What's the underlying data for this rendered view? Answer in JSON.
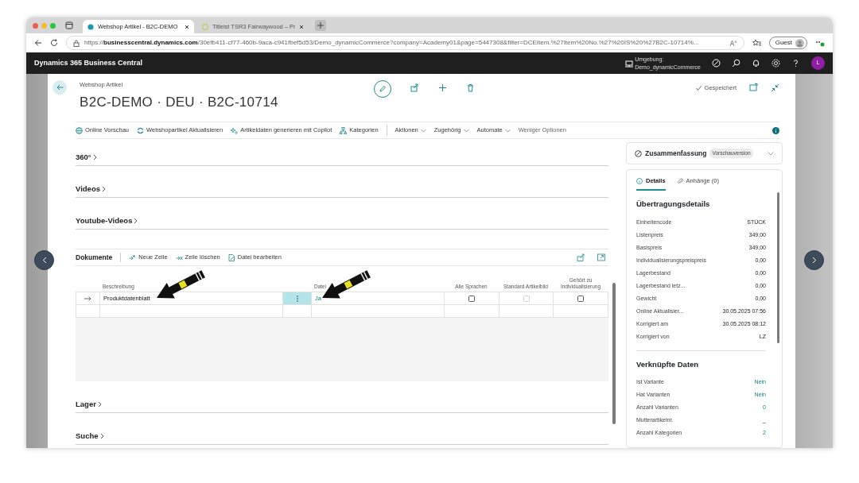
{
  "browser": {
    "tabs": [
      {
        "title": "Webshop Artikel - B2C-DEMO",
        "selected": true
      },
      {
        "title": "Titleist TSR3 Fairwaywood – Pr",
        "selected": false
      }
    ],
    "url": {
      "scheme": "https://",
      "host": "businesscentral.dynamics.com",
      "rest": "/30efb411-cf77-460b-9aca-c941fbef5d53/Demo_dynamicCommerce?company=Academy01&page=5447308&filter=DCEItem.%27Item%20No.%27%20IS%20%27B2C-10714%..."
    },
    "profile": "Guest"
  },
  "app": {
    "title": "Dynamics 365 Business Central",
    "environment_label": "Umgebung:",
    "environment": "Demo_dynamicCommerce",
    "avatar": "L"
  },
  "page": {
    "caption": "Webshop Artikel",
    "title": "B2C-DEMO · DEU · B2C-10714",
    "status": "Gespeichert",
    "actions": [
      {
        "label": "Online Vorschau",
        "kind": "button"
      },
      {
        "label": "Webshopartikel Aktualisieren",
        "kind": "button"
      },
      {
        "label": "Artikeldaten generieren mit Copilot",
        "kind": "button"
      },
      {
        "label": "Kategorien",
        "kind": "button"
      },
      {
        "label": "Aktionen",
        "kind": "menu"
      },
      {
        "label": "Zugehörig",
        "kind": "menu"
      },
      {
        "label": "Automate",
        "kind": "menu"
      },
      {
        "label": "Weniger Optionen",
        "kind": "link"
      }
    ]
  },
  "sections_before": [
    {
      "title": "360°"
    },
    {
      "title": "Videos"
    },
    {
      "title": "Youtube-Videos"
    }
  ],
  "documents": {
    "title": "Dokumente",
    "actions": [
      "Neue Zeile",
      "Zeile löschen",
      "Datei bearbeiten"
    ],
    "columns": [
      "Beschreibung",
      "Datei",
      "Alle Sprachen",
      "Standard Artikelbild",
      "Gehört zu Individualisierung"
    ],
    "rows": [
      {
        "current": true,
        "description": "Produktdatenblatt",
        "file": "Ja",
        "all_languages": false,
        "standard_image": false,
        "standard_disabled": true,
        "customization": false
      },
      {
        "current": false
      }
    ]
  },
  "sections_after": [
    {
      "title": "Lager"
    },
    {
      "title": "Suche"
    }
  ],
  "factbox": {
    "title": "Zusammenfassung",
    "badge": "Vorschauversion",
    "tabs": [
      {
        "label": "Details",
        "selected": true
      },
      {
        "label": "Anhänge (0)",
        "selected": false
      }
    ],
    "groups": [
      {
        "title": "Übertragungsdetails",
        "fields": [
          {
            "label": "Einheitencode",
            "value": "STÜCK",
            "link": false
          },
          {
            "label": "Listenpreis",
            "value": "349,00",
            "link": false
          },
          {
            "label": "Basispreis",
            "value": "349,00",
            "link": false
          },
          {
            "label": "Individualisierungspreispreis",
            "value": "0,00",
            "link": false
          },
          {
            "label": "Lagerbestand",
            "value": "0,00",
            "link": false
          },
          {
            "label": "Lagerbestand letz...",
            "value": "0,00",
            "link": false
          },
          {
            "label": "Gewicht",
            "value": "0,00",
            "link": false
          },
          {
            "label": "Online Aktualisier...",
            "value": "30.05.2025 07:56",
            "link": false
          },
          {
            "label": "Korrigiert am",
            "value": "30.05.2025 08:12",
            "link": false
          },
          {
            "label": "Korrigiert von",
            "value": "LZ",
            "link": false
          }
        ]
      },
      {
        "title": "Verknüpfte Daten",
        "fields": [
          {
            "label": "Ist Variante",
            "value": "Nein",
            "link": true
          },
          {
            "label": "Hat Varianten",
            "value": "Nein",
            "link": true
          },
          {
            "label": "Anzahl Varianten",
            "value": "0",
            "link": true
          },
          {
            "label": "Mutterartikelnr.",
            "value": "_",
            "link": false
          },
          {
            "label": "Anzahl Kategorien",
            "value": "2",
            "link": true
          }
        ]
      }
    ]
  }
}
